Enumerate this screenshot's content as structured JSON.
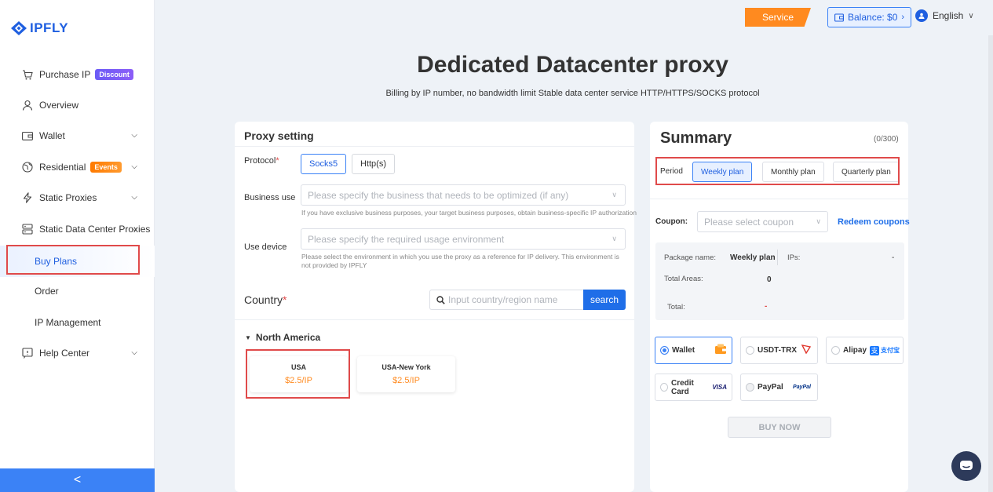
{
  "brand": {
    "name": "IPFLY"
  },
  "sidebar": {
    "items": [
      {
        "label": "Purchase IP",
        "icon": "cart-icon",
        "badge": "Discount"
      },
      {
        "label": "Overview",
        "icon": "user-icon"
      },
      {
        "label": "Wallet",
        "icon": "wallet-icon"
      },
      {
        "label": "Residential",
        "icon": "globe-icon",
        "badge": "Events"
      },
      {
        "label": "Static Proxies",
        "icon": "lightning-icon"
      },
      {
        "label": "Static Data Center Proxies",
        "icon": "server-icon"
      }
    ],
    "sub_items": [
      {
        "label": "Buy Plans",
        "active": true
      },
      {
        "label": "Order"
      },
      {
        "label": "IP Management"
      }
    ],
    "help": {
      "label": "Help Center",
      "icon": "help-icon"
    },
    "collapse_glyph": "<"
  },
  "topbar": {
    "service_label": "Service",
    "balance_label": "Balance: $0",
    "language": "English"
  },
  "header": {
    "title": "Dedicated Datacenter proxy",
    "subtitle": "Billing by IP number, no bandwidth limit Stable data center service HTTP/HTTPS/SOCKS protocol"
  },
  "proxy_setting": {
    "title": "Proxy setting",
    "protocol_label": "Protocol",
    "protocols": [
      "Socks5",
      "Http(s)"
    ],
    "business_label": "Business use",
    "business_placeholder": "Please specify the business that needs to be optimized (if any)",
    "business_hint": "If you have exclusive business purposes, your target business purposes, obtain business-specific IP authorization",
    "device_label": "Use device",
    "device_placeholder": "Please specify the required usage environment",
    "device_hint": "Please select the environment in which you use the proxy as a reference for IP delivery. This environment is not provided by IPFLY",
    "country_label": "Country",
    "search_placeholder": "Input country/region name",
    "search_button": "search",
    "region": "North America",
    "countries": [
      {
        "name": "USA",
        "price": "$2.5/IP"
      },
      {
        "name": "USA-New York",
        "price": "$2.5/IP"
      }
    ]
  },
  "summary": {
    "title": "Summary",
    "count": "(0/300)",
    "period_label": "Period",
    "periods": [
      "Weekly plan",
      "Monthly plan",
      "Quarterly plan"
    ],
    "coupon_label": "Coupon:",
    "coupon_placeholder": "Please select coupon",
    "redeem_label": "Redeem coupons",
    "package_name_label": "Package name:",
    "package_name_value": "Weekly plan",
    "ips_label": "IPs:",
    "ips_value": "-",
    "total_areas_label": "Total Areas:",
    "total_areas_value": "0",
    "total_label": "Total:",
    "total_value": "-",
    "payments": [
      "Wallet",
      "USDT-TRX",
      "Alipay",
      "Credit Card",
      "PayPal"
    ],
    "visa_text": "VISA",
    "paypal_text": "PayPal",
    "alipay_text": "支付宝",
    "buy_now": "BUY NOW"
  },
  "colors": {
    "accent": "#1f6ee8",
    "orange": "#ff8a1f",
    "highlight": "#e04a4a"
  }
}
